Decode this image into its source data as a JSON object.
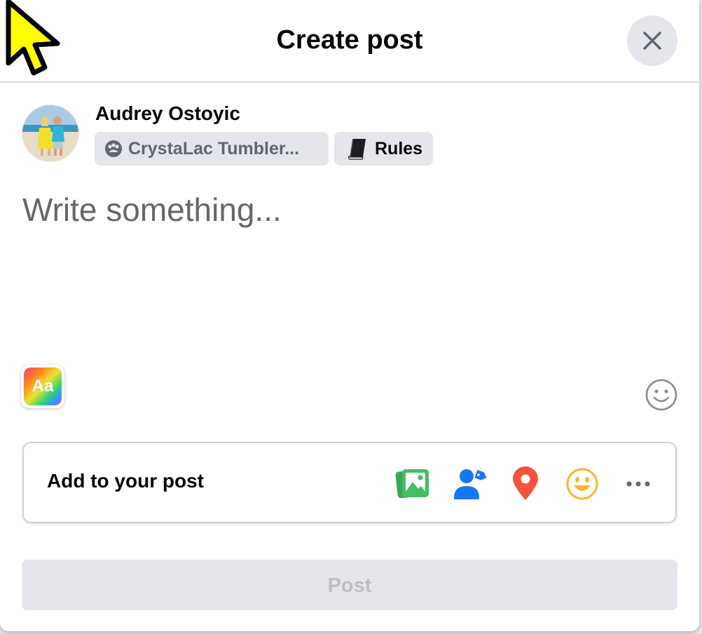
{
  "dialog": {
    "title": "Create post",
    "close_icon": "close-icon"
  },
  "author": {
    "name": "Audrey Ostoyic",
    "group_chip": {
      "icon": "group-icon",
      "label": "CrystaLac Tumbler..."
    },
    "rules_chip": {
      "icon": "book-icon",
      "label": "Rules"
    }
  },
  "composer": {
    "placeholder": "Write something...",
    "value": "",
    "text_format_icon": {
      "name": "text-format-icon",
      "label": "Aa"
    },
    "emoji_icon": "smiley-face-icon"
  },
  "add_to_post": {
    "label": "Add to your post",
    "icons": [
      {
        "name": "photo-video-icon",
        "color": "#45bd62"
      },
      {
        "name": "tag-people-icon",
        "color": "#1877f2"
      },
      {
        "name": "location-icon",
        "color": "#f5533d"
      },
      {
        "name": "feeling-icon",
        "color": "#f7b928"
      },
      {
        "name": "more-icon",
        "color": "#65676b"
      }
    ]
  },
  "post_button": {
    "label": "Post",
    "enabled": false
  },
  "colors": {
    "primary_text": "#050505",
    "secondary_text": "#65676b",
    "chip_background": "#e4e6eb",
    "disabled_text": "#bcc0c4"
  }
}
